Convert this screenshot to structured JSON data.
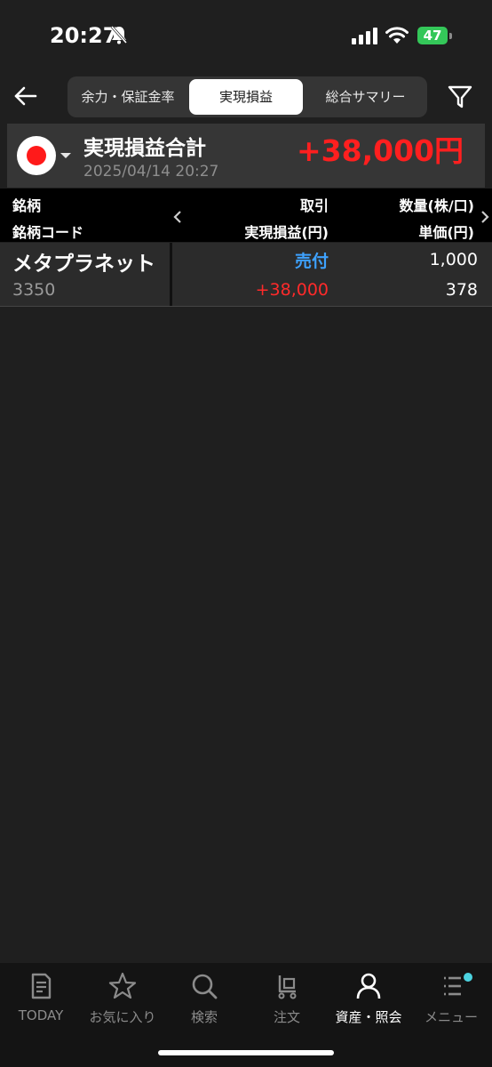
{
  "status": {
    "time": "20:27",
    "battery": "47"
  },
  "nav": {
    "tabs": [
      {
        "label": "余力・保証金率"
      },
      {
        "label": "実現損益",
        "active": true
      },
      {
        "label": "総合サマリー"
      }
    ]
  },
  "summary": {
    "title": "実現損益合計",
    "datetime": "2025/04/14 20:27",
    "amount": "+38,000円"
  },
  "table": {
    "headers": {
      "col1_top": "銘柄",
      "col1_bottom": "銘柄コード",
      "col2_top": "取引",
      "col2_bottom": "実現損益(円)",
      "col3_top": "数量(株/口)",
      "col3_bottom": "単価(円)"
    },
    "rows": [
      {
        "name": "メタプラネット",
        "code": "3350",
        "trade": "売付",
        "pl": "+38,000",
        "qty": "1,000",
        "price": "378"
      }
    ]
  },
  "tabbar": {
    "items": [
      {
        "label": "TODAY",
        "icon": "news-icon"
      },
      {
        "label": "お気に入り",
        "icon": "star-icon"
      },
      {
        "label": "検索",
        "icon": "search-icon"
      },
      {
        "label": "注文",
        "icon": "cart-icon"
      },
      {
        "label": "資産・照会",
        "icon": "person-icon",
        "active": true
      },
      {
        "label": "メニュー",
        "icon": "menu-icon"
      }
    ]
  },
  "colors": {
    "accent_red": "#ff1f1f",
    "accent_blue": "#3ea2ff",
    "battery_green": "#34c759"
  }
}
